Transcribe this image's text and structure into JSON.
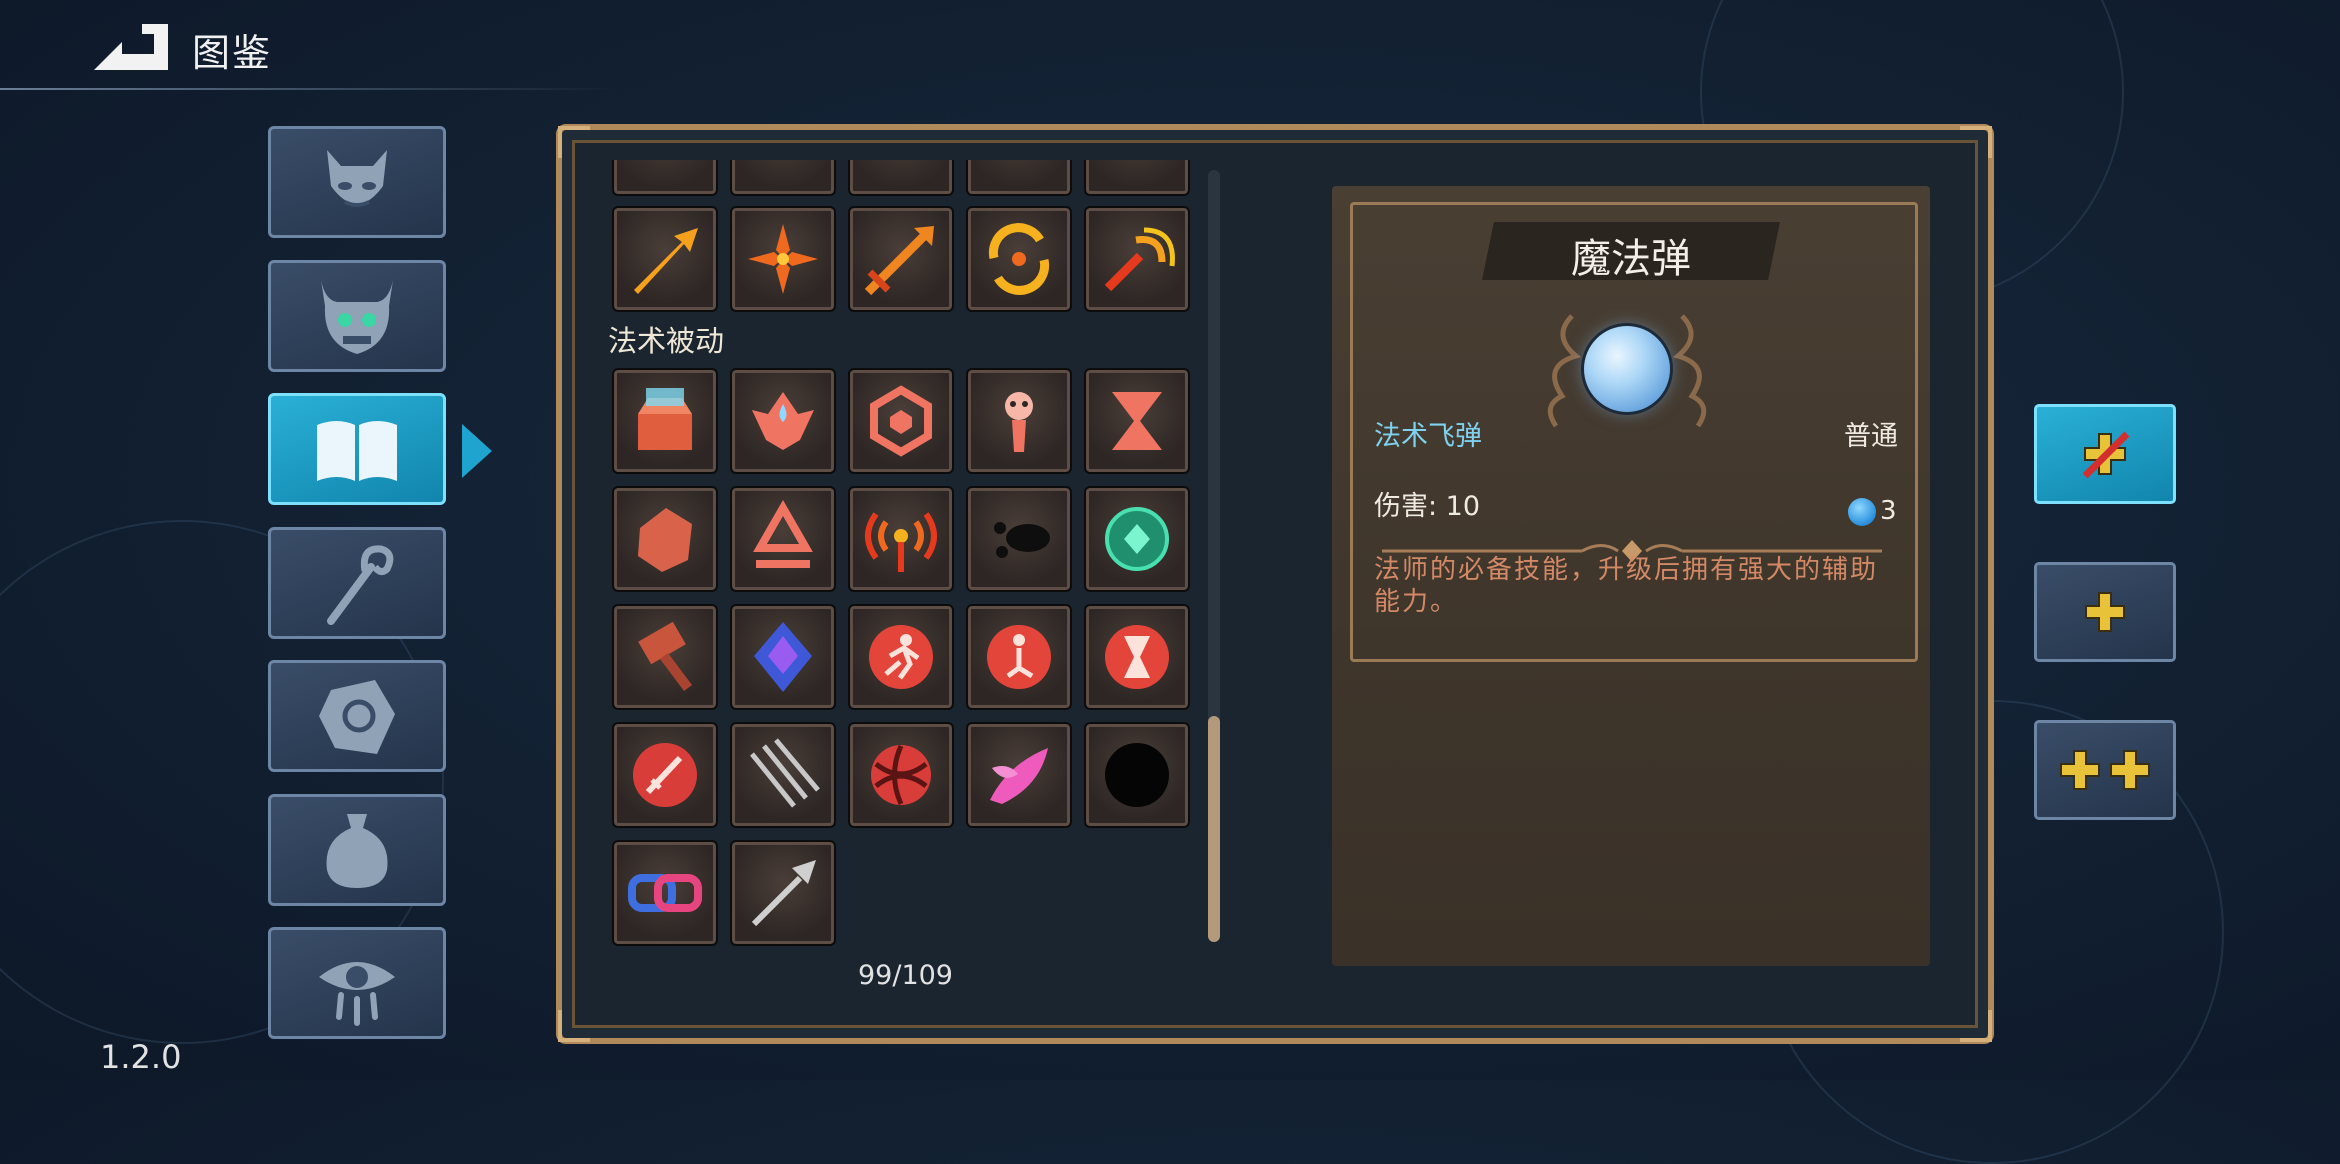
{
  "header": {
    "title": "图鉴",
    "back_icon": "back-arrow-icon"
  },
  "version": "1.2.0",
  "categories": [
    {
      "name": "demon-face-icon",
      "active": false
    },
    {
      "name": "horned-skull-icon",
      "active": false
    },
    {
      "name": "open-book-icon",
      "active": true
    },
    {
      "name": "staff-icon",
      "active": false
    },
    {
      "name": "rune-stone-icon",
      "active": false
    },
    {
      "name": "pouch-icon",
      "active": false
    },
    {
      "name": "crying-eye-icon",
      "active": false
    }
  ],
  "grid": {
    "section_label": "法术被动",
    "count": "99/109",
    "top_row": [
      "fire-arrow-icon",
      "fire-burst-icon",
      "double-arrow-icon",
      "fire-cycle-icon",
      "fire-spiral-icon"
    ],
    "passive_items": [
      "treasure-chest-icon",
      "blood-drop-flower-icon",
      "hexagon-shield-icon",
      "spirit-icon",
      "hourglass-icon",
      "rock-icon",
      "diamond-rune-icon",
      "radio-signal-icon",
      "shadow-dash-icon",
      "emerald-orb-icon",
      "hammer-icon",
      "sapphire-crystal-icon",
      "runner-seal-icon",
      "kneel-seal-icon",
      "hourglass-seal-icon",
      "sword-seal-icon",
      "triple-blade-icon",
      "curse-ball-icon",
      "pink-leaf-icon",
      "black-bomb-icon",
      "linked-chains-icon",
      "spear-icon"
    ]
  },
  "detail": {
    "name": "魔法弹",
    "type": "法术飞弹",
    "rarity": "普通",
    "damage_label": "伤害: 10",
    "mana_cost": "3",
    "description": "法师的必备技能，升级后拥有强大的辅助能力。"
  },
  "level_buttons": [
    {
      "name": "level-none-icon",
      "active": true
    },
    {
      "name": "plus-one-icon",
      "active": false
    },
    {
      "name": "plus-two-icon",
      "active": false
    }
  ],
  "colors": {
    "accent": "#1fa3cf",
    "panel": "#3e352b",
    "gold": "#e8c33a"
  }
}
